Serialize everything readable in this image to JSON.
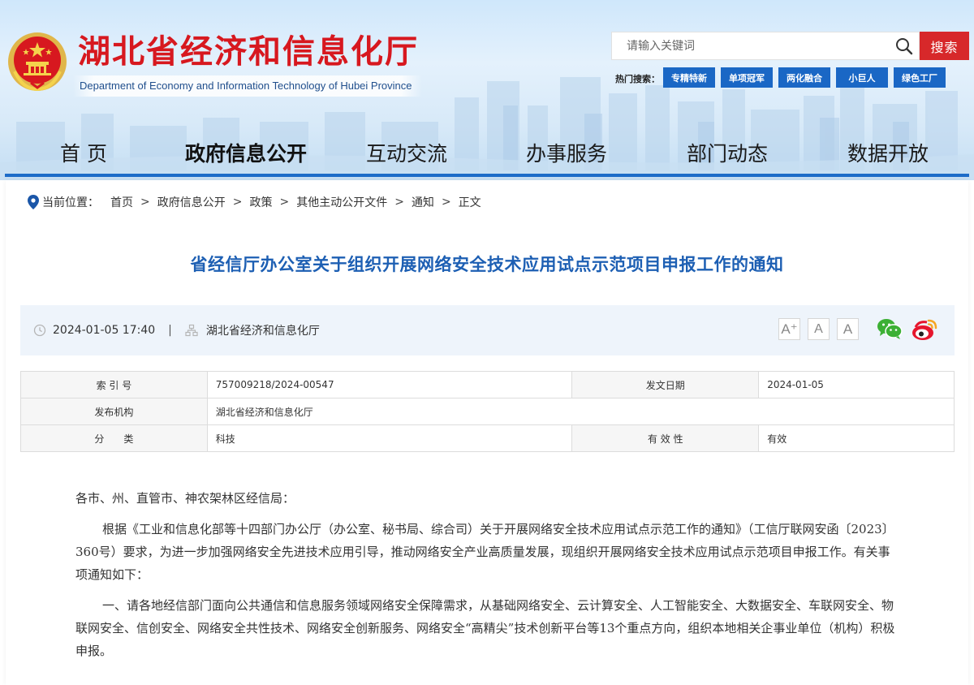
{
  "header": {
    "site_title": "湖北省经济和信息化厅",
    "site_subtitle": "Department of Economy and Information Technology of Hubei Province",
    "search_placeholder": "请输入关键词",
    "search_button": "搜索",
    "hot_label": "热门搜索：",
    "hot_tags": [
      "专精特新",
      "单项冠军",
      "两化融合",
      "小巨人",
      "绿色工厂"
    ]
  },
  "nav": {
    "items": [
      "首 页",
      "政府信息公开",
      "互动交流",
      "办事服务",
      "部门动态",
      "数据开放"
    ],
    "active": "政府信息公开"
  },
  "breadcrumb": {
    "prefix": "当前位置：",
    "items": [
      "首页",
      "政府信息公开",
      "政策",
      "其他主动公开文件",
      "通知",
      "正文"
    ],
    "separator": ">"
  },
  "article": {
    "title": "省经信厅办公室关于组织开展网络安全技术应用试点示范项目申报工作的通知",
    "datetime": "2024-01-05 17:40",
    "divider": "|",
    "source": "湖北省经济和信息化厅",
    "font_sizes": [
      "A⁺",
      "A",
      "A"
    ]
  },
  "info": {
    "index_label": "索 引 号",
    "index_value": "757009218/2024-00547",
    "date_label": "发文日期",
    "date_value": "2024-01-05",
    "publisher_label": "发布机构",
    "publisher_value": "湖北省经济和信息化厅",
    "category_label": "分　　类",
    "category_value": "科技",
    "validity_label": "有 效 性",
    "validity_value": "有效"
  },
  "body": {
    "salutation": "各市、州、直管市、神农架林区经信局：",
    "para1": "根据《工业和信息化部等十四部门办公厅（办公室、秘书局、综合司）关于开展网络安全技术应用试点示范工作的通知》（工信厅联网安函〔2023〕360号）要求，为进一步加强网络安全先进技术应用引导，推动网络安全产业高质量发展，现组织开展网络安全技术应用试点示范项目申报工作。有关事项通知如下：",
    "para2": "一、请各地经信部门面向公共通信和信息服务领域网络安全保障需求，从基础网络安全、云计算安全、人工智能安全、大数据安全、车联网安全、物联网安全、信创安全、网络安全共性技术、网络安全创新服务、网络安全“高精尖”技术创新平台等13个重点方向，组织本地相关企事业单位（机构）积极申报。"
  },
  "colors": {
    "title_red": "#d7181f",
    "nav_blue": "#1d6cc8",
    "tag_blue": "#1a67c5",
    "search_red": "#d7282a",
    "article_title_blue": "#1d5fb3"
  }
}
